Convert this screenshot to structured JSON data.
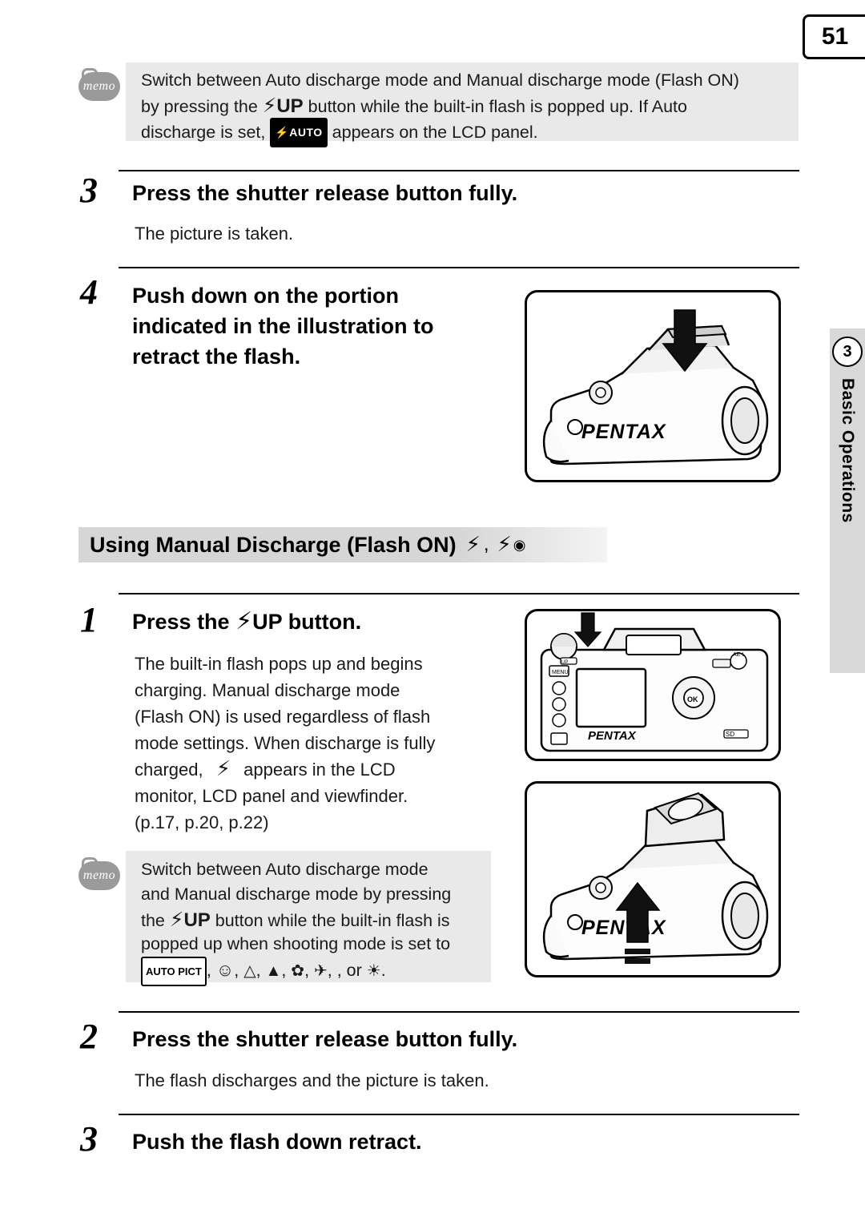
{
  "page": {
    "number": "51",
    "chapter_number": "3",
    "chapter_name": "Basic Operations"
  },
  "memo_top": {
    "icon_label": "memo",
    "line1": "Switch between Auto discharge mode and Manual discharge mode (Flash ON)",
    "line2_part1": "by pressing the ",
    "line2_flash_up": "UP",
    "line2_part2": " button while the built-in flash is popped up. If Auto",
    "line3_part1": "discharge is set, ",
    "line3_badge": "AUTO",
    "line3_part2": " appears on the LCD panel."
  },
  "steps_top": [
    {
      "number": "3",
      "title": "Press the shutter release button fully.",
      "body": "The picture is taken."
    },
    {
      "number": "4",
      "title": "Push down on the portion indicated in the illustration to retract the flash.",
      "body": ""
    }
  ],
  "section": {
    "title_text": "Using Manual Discharge (Flash ON)",
    "title_glyph_1": "flash-icon",
    "title_glyph_2": "flash-redeye-icon"
  },
  "steps_bottom": [
    {
      "number": "1",
      "title_prefix": "Press the ",
      "title_flash": "UP",
      "title_suffix": " button.",
      "body_lines": [
        "The built-in flash pops up and begins",
        "charging. Manual discharge mode",
        "(Flash ON) is used regardless of flash",
        "mode settings. When discharge is fully",
        "charged,",
        "appears in the LCD",
        "monitor, LCD panel and viewfinder.",
        "(p.17, p.20, p.22)"
      ]
    },
    {
      "number": "2",
      "title": "Press the shutter release button fully.",
      "body": "The flash discharges and the picture is taken."
    },
    {
      "number": "3",
      "title": "Push the flash down retract.",
      "body": ""
    }
  ],
  "memo_bottom": {
    "icon_label": "memo",
    "line1": "Switch between Auto discharge mode",
    "line2": "and Manual discharge mode by pressing",
    "line3_part1": "the ",
    "line3_flash_up": "UP",
    "line3_part2": " button while the built-in flash is",
    "line4": "popped up when shooting mode is set to",
    "line5_badge": "AUTO PICT",
    "line5_rest": ", or"
  },
  "illustrations": {
    "camera_retract_flash": "camera-push-flash-down-illustration",
    "camera_back_panel": "camera-back-panel-illustration",
    "camera_flash_popup": "camera-flash-pop-up-illustration",
    "brand": "PENTAX"
  }
}
